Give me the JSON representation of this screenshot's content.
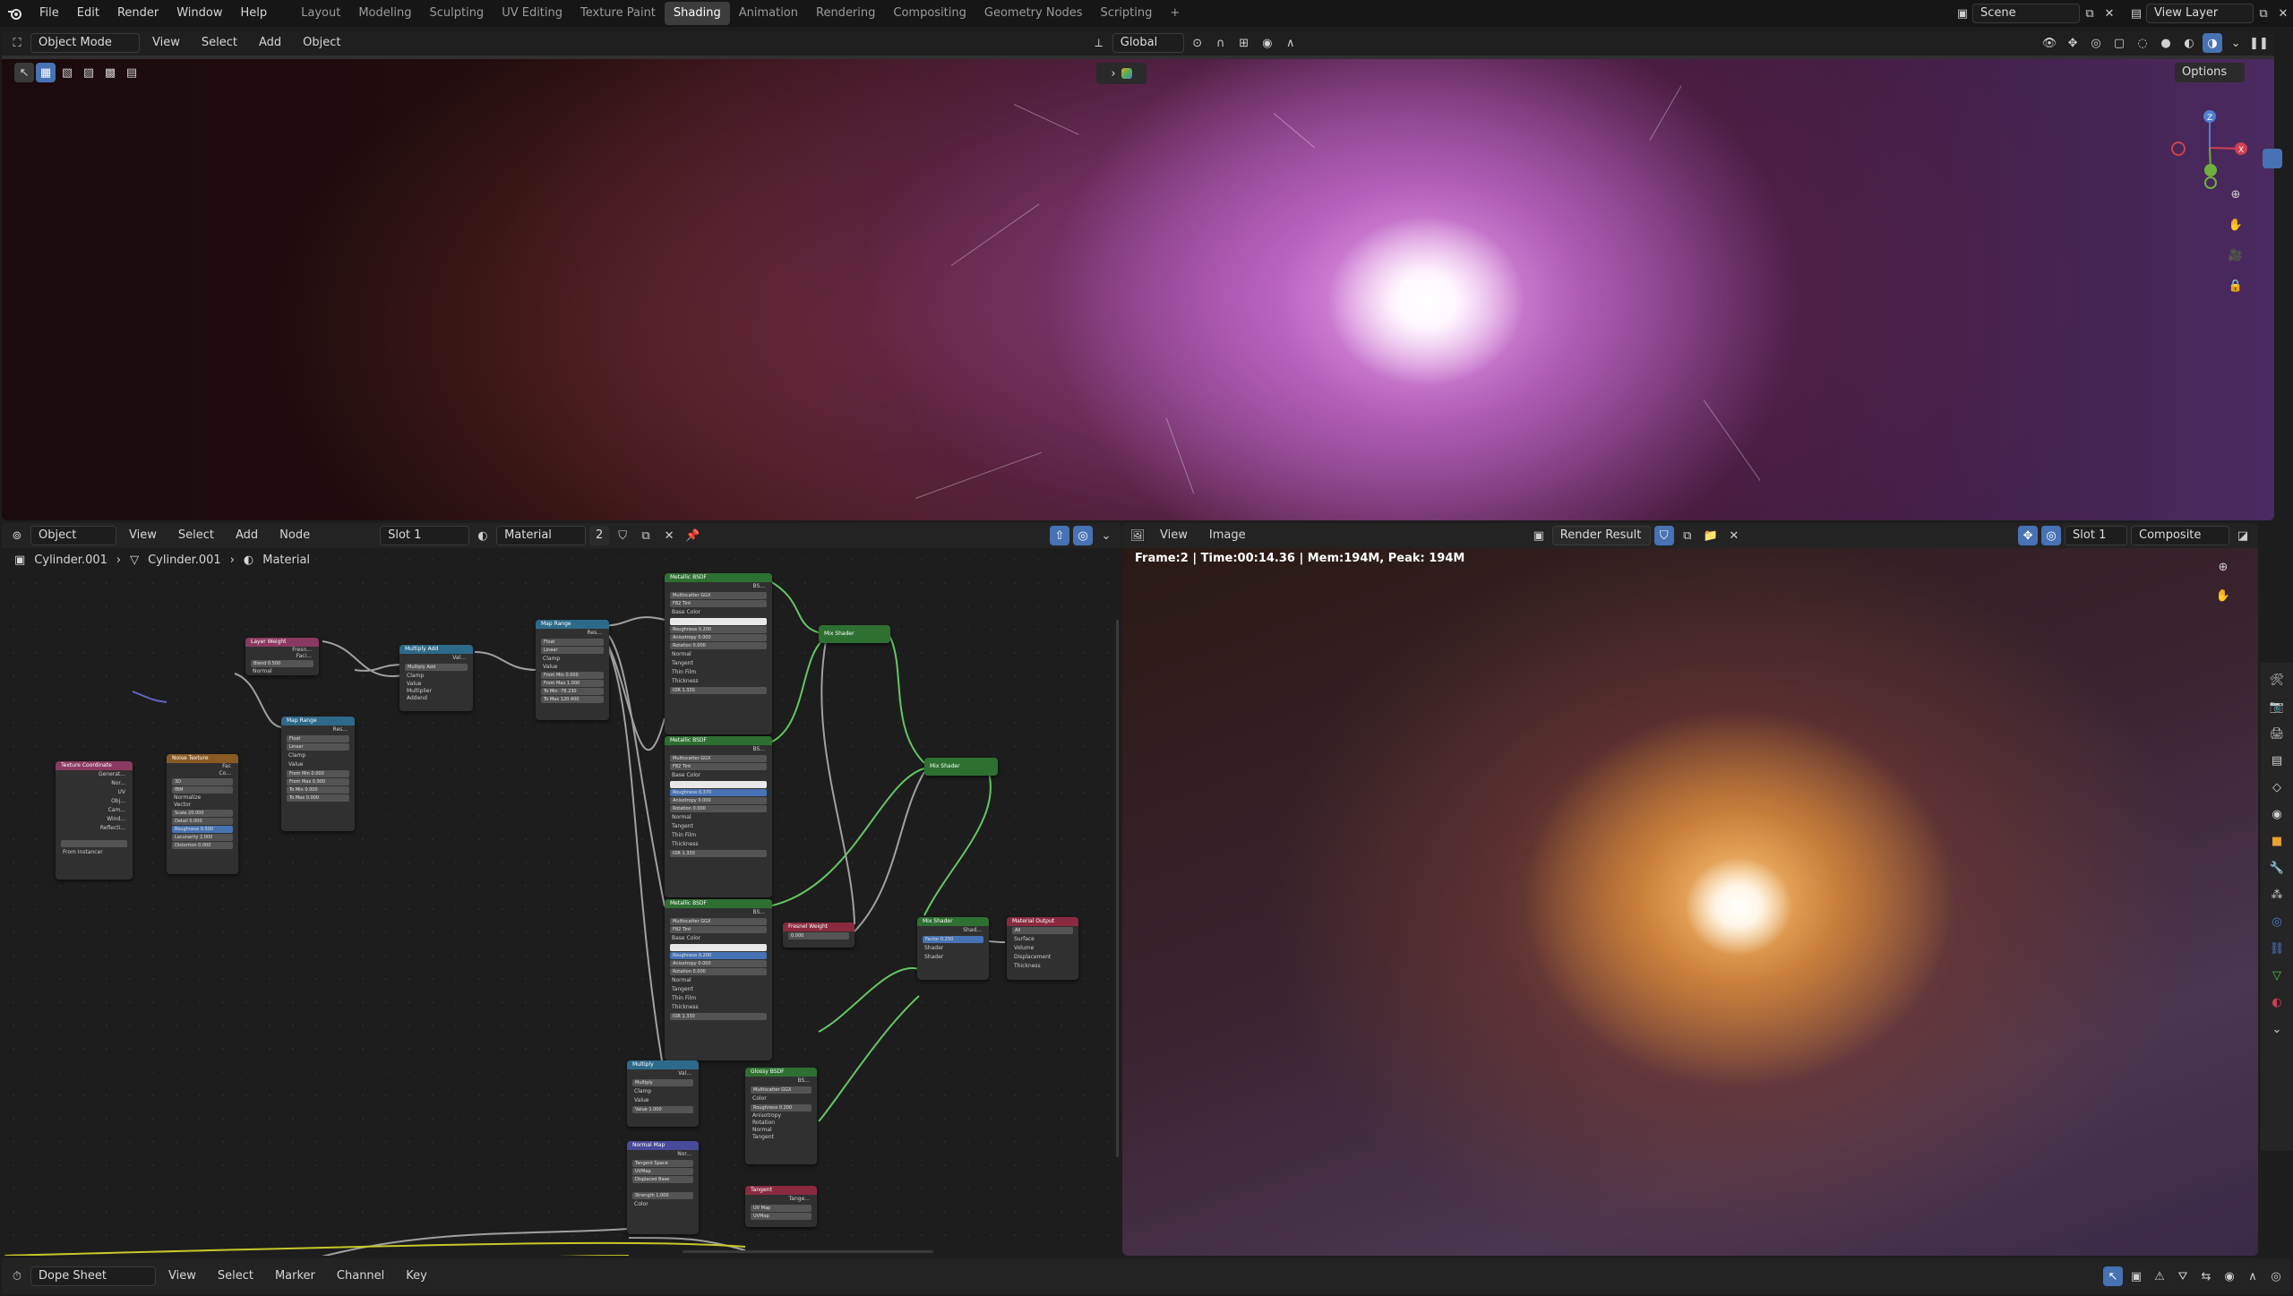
{
  "top_menu": [
    "File",
    "Edit",
    "Render",
    "Window",
    "Help"
  ],
  "workspaces": [
    "Layout",
    "Modeling",
    "Sculpting",
    "UV Editing",
    "Texture Paint",
    "Shading",
    "Animation",
    "Rendering",
    "Compositing",
    "Geometry Nodes",
    "Scripting"
  ],
  "active_workspace": "Shading",
  "scene": "Scene",
  "view_layer": "View Layer",
  "viewport": {
    "mode": "Object Mode",
    "menus": [
      "View",
      "Select",
      "Add",
      "Object"
    ],
    "transform_orientation": "Global",
    "options": "Options"
  },
  "node_editor": {
    "type": "Object",
    "menus": [
      "View",
      "Select",
      "Add",
      "Node"
    ],
    "slot": "Slot 1",
    "material": "Material",
    "users": "2",
    "breadcrumb": [
      "Cylinder.001",
      "Cylinder.001",
      "Material"
    ],
    "nodes": {
      "metallic_a": {
        "title": "Metallic BSDF",
        "out": "BS...",
        "rows": [
          "Multiscatter GGX",
          "F82 Tint",
          "Base Color",
          "Edge Tint",
          "Roughness  0.200",
          "Anisotropy  0.000",
          "Rotation  0.000",
          "Normal",
          "Tangent",
          "Thin Film",
          "Thickness",
          "IOR  1.330"
        ]
      },
      "metallic_b": {
        "title": "Metallic BSDF",
        "out": "BS...",
        "rows": [
          "Multiscatter GGX",
          "F82 Tint",
          "Base Color",
          "Edge Tint",
          "Roughness  0.370",
          "Anisotropy  0.000",
          "Rotation  0.000",
          "Normal",
          "Tangent",
          "Thin Film",
          "Thickness",
          "IOR  1.330"
        ]
      },
      "metallic_c": {
        "title": "Metallic BSDF",
        "out": "BS...",
        "rows": [
          "Multiscatter GGX",
          "F82 Tint",
          "Base Color",
          "Edge Tint",
          "Roughness  0.200",
          "Anisotropy  0.000",
          "Rotation  0.000",
          "Normal",
          "Tangent",
          "Thin Film",
          "Thickness",
          "IOR  1.330"
        ]
      },
      "mix_shader_1": {
        "title": "Mix Shader"
      },
      "mix_shader_2": {
        "title": "Mix Shader"
      },
      "mix_shader_3": {
        "title": "Mix Shader",
        "rows": [
          "Shad...",
          "Factor  0.250",
          "Shader",
          "Shader"
        ]
      },
      "layer_weight": {
        "title": "Layer Weight",
        "rows": [
          "Fresn...",
          "Faci...",
          "Blend  0.500",
          "Normal"
        ]
      },
      "multiply_add": {
        "title": "Multiply Add",
        "rows": [
          "Val...",
          "Multiply Add",
          "Clamp",
          "Value",
          "Multiplier",
          "Addend"
        ]
      },
      "map_range_1": {
        "title": "Map Range",
        "rows": [
          "Res...",
          "Float",
          "Linear",
          "Clamp",
          "Value",
          "From Min  0.000",
          "From Max  1.000",
          "To Min  -78.230",
          "To Max  120.400"
        ]
      },
      "map_range_2": {
        "title": "Map Range",
        "rows": [
          "Res...",
          "Float",
          "Linear",
          "Clamp",
          "Value",
          "From Min  0.000",
          "From Max  0.900",
          "To Min  0.000",
          "To Max  0.000"
        ]
      },
      "texture_coord": {
        "title": "Texture Coordinate",
        "rows": [
          "Generat...",
          "Nor...",
          "UV",
          "Obj...",
          "Cam...",
          "Wind...",
          "Reflecti...",
          "From Instancer"
        ]
      },
      "noise_texture": {
        "title": "Noise Texture",
        "rows": [
          "Fac",
          "Co...",
          "3D",
          "fBM",
          "Normalize",
          "Vector",
          "Scale  20.000",
          "Detail  0.000",
          "Roughness  0.500",
          "Lacunarity  2.000",
          "Distortion  0.000"
        ]
      },
      "fresnel_weight": {
        "title": "Fresnel Weight",
        "rows": [
          "0.000"
        ]
      },
      "material_output": {
        "title": "Material Output",
        "rows": [
          "All",
          "Surface",
          "Volume",
          "Displacement",
          "Thickness"
        ]
      },
      "multiply": {
        "title": "Multiply",
        "rows": [
          "Val...",
          "Multiply",
          "Clamp",
          "Value",
          "Value  1.000"
        ]
      },
      "glossy": {
        "title": "Glossy BSDF",
        "rows": [
          "BS...",
          "Multiscatter GGX",
          "Color",
          "Roughness  0.200",
          "Anisotropy",
          "Rotation",
          "Normal",
          "Tangent"
        ]
      },
      "normal_map": {
        "title": "Normal Map",
        "rows": [
          "Nor...",
          "Tangent Space",
          "UVMap",
          "Displaced Base",
          "Strength  1.000",
          "Color"
        ]
      },
      "tangent": {
        "title": "Tangent",
        "rows": [
          "Tange...",
          "UV Map",
          "UVMap"
        ]
      }
    }
  },
  "image_editor": {
    "menus": [
      "View",
      "Image"
    ],
    "image": "Render Result",
    "slot": "Slot 1",
    "pass": "Composite",
    "stats": "Frame:2 | Time:00:14.36 | Mem:194M, Peak: 194M"
  },
  "dope_sheet": {
    "type": "Dope Sheet",
    "menus": [
      "View",
      "Select",
      "Marker",
      "Channel",
      "Key"
    ]
  },
  "colors": {
    "accent": "#4772b3",
    "socket_green": "#63c763",
    "socket_yellow": "#c7c729",
    "socket_gray": "#a1a1a1",
    "socket_purple": "#6363c7"
  }
}
